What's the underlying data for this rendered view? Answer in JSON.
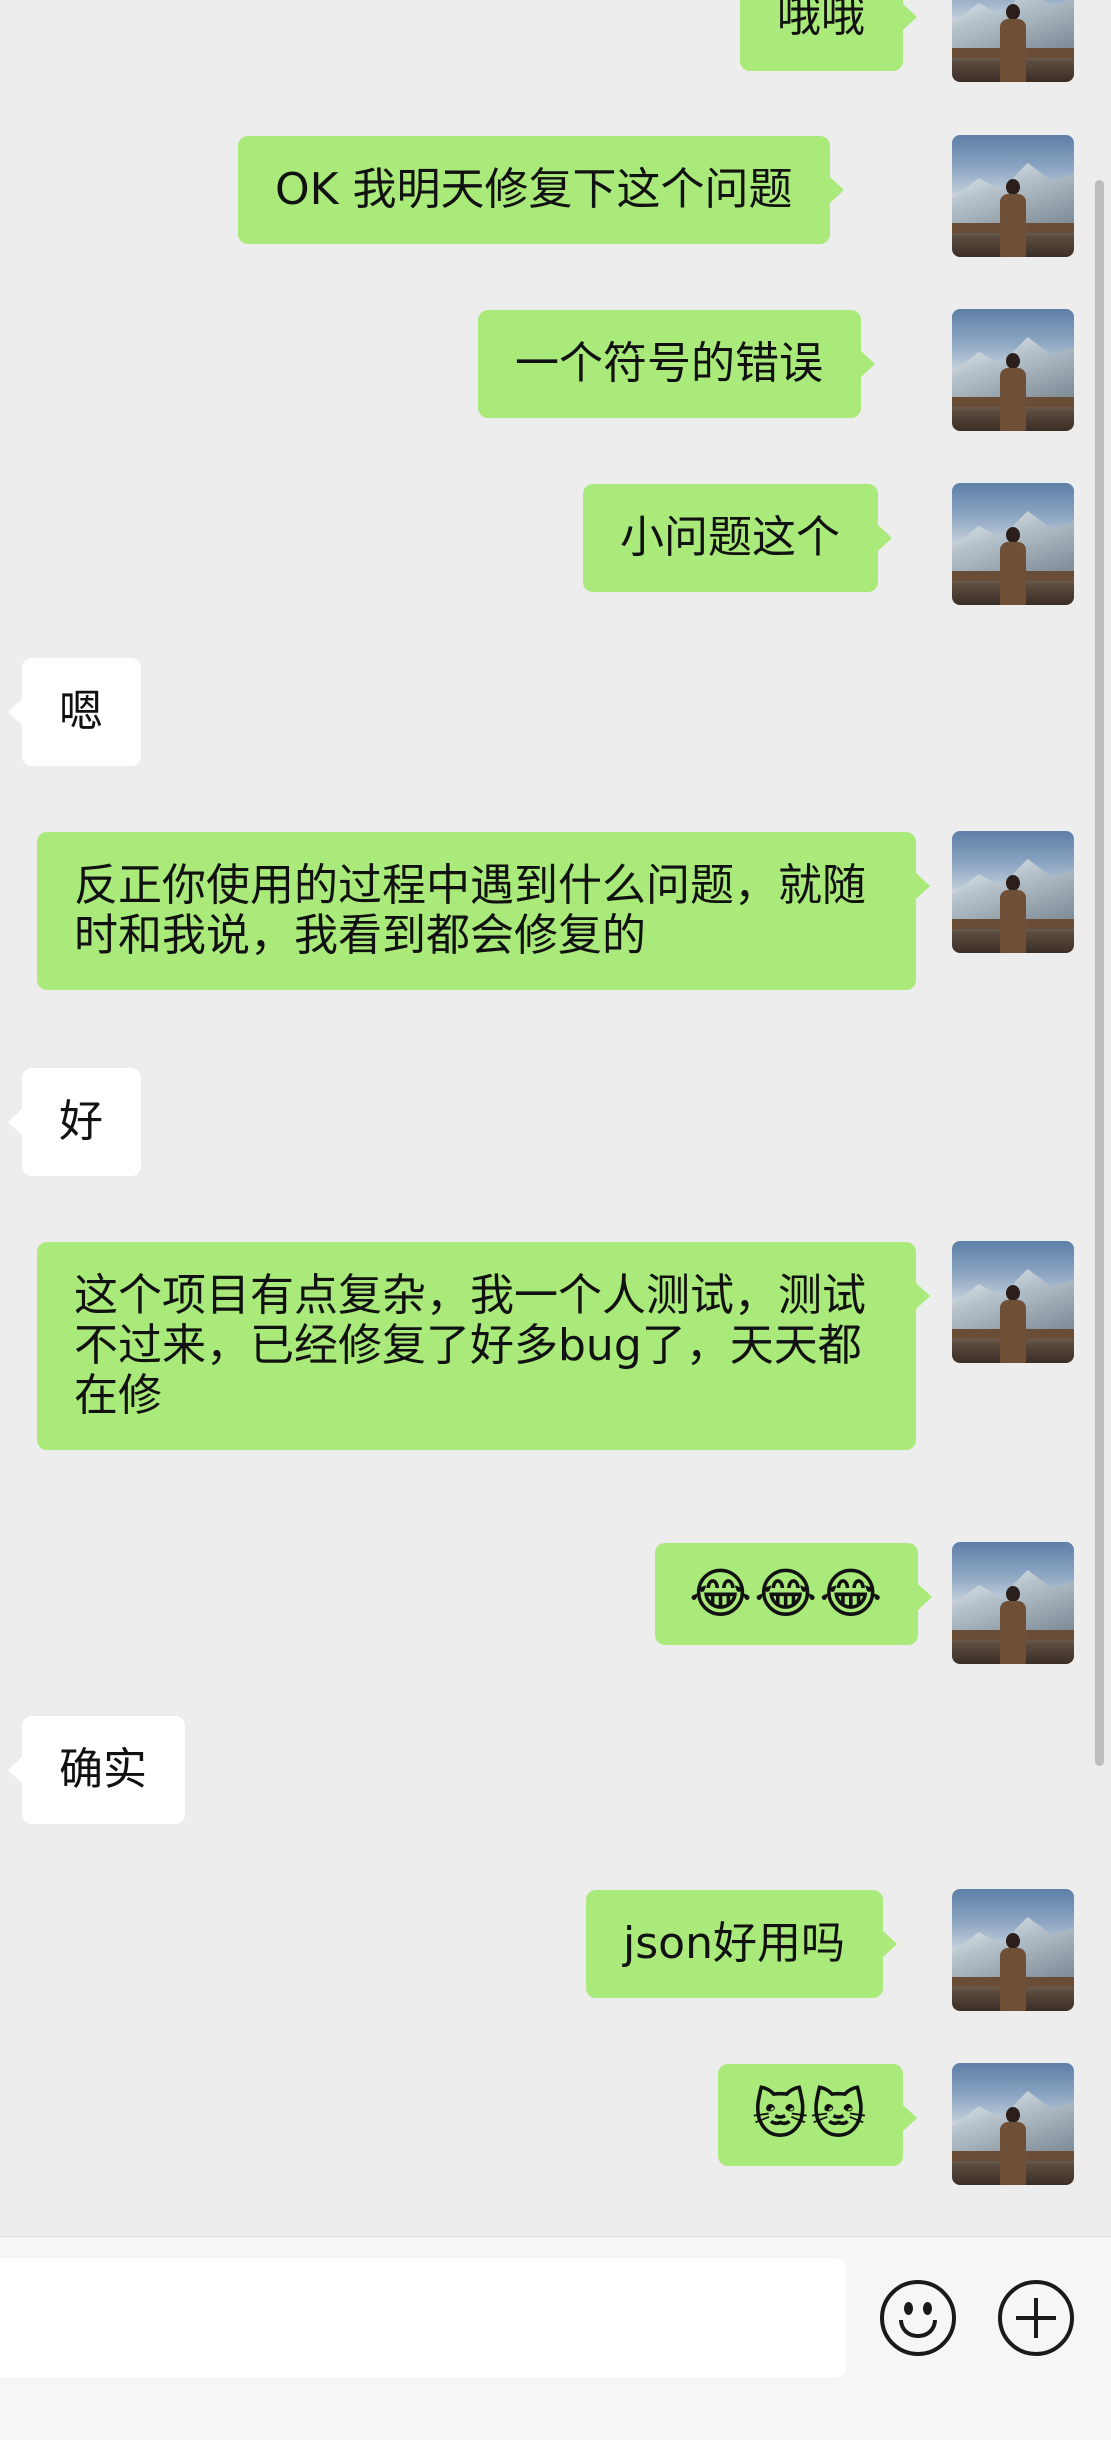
{
  "messages": [
    {
      "side": "right",
      "text": "哦哦"
    },
    {
      "side": "right",
      "text": "OK 我明天修复下这个问题"
    },
    {
      "side": "right",
      "text": "一个符号的错误"
    },
    {
      "side": "right",
      "text": "小问题这个"
    },
    {
      "side": "left",
      "text": "嗯"
    },
    {
      "side": "right",
      "text": "反正你使用的过程中遇到什么问题，就随时和我说，我看到都会修复的"
    },
    {
      "side": "left",
      "text": "好"
    },
    {
      "side": "right",
      "text": "这个项目有点复杂，我一个人测试，测试不过来，已经修复了好多bug了，天天都在修"
    },
    {
      "side": "right",
      "text": "😂😂😂"
    },
    {
      "side": "left",
      "text": "确实"
    },
    {
      "side": "right",
      "text": "json好用吗"
    },
    {
      "side": "right",
      "text": "🐱🐱"
    }
  ],
  "input_bar": {
    "placeholder": "",
    "emoji_icon": "emoji-face-icon",
    "plus_icon": "plus-circle-icon"
  },
  "colors": {
    "background": "#ededed",
    "bubble_sent": "#a9ea7a",
    "bubble_received": "#ffffff"
  }
}
